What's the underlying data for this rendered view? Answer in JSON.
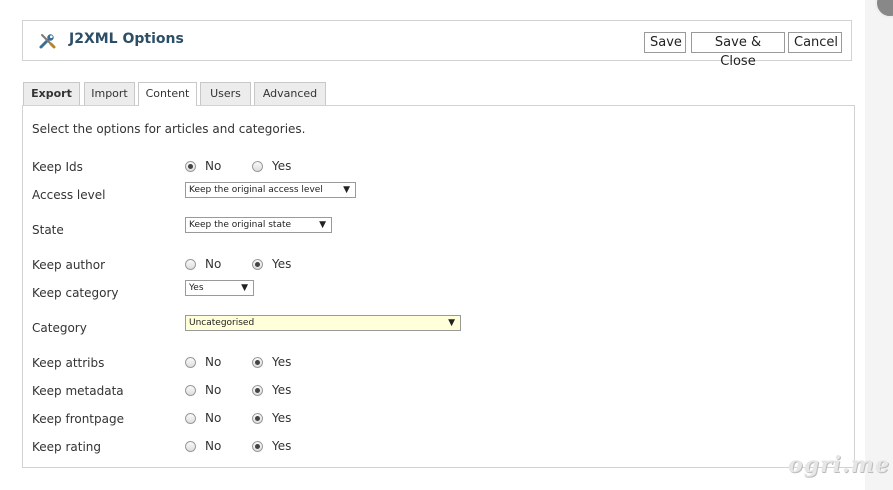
{
  "header": {
    "icon": "wrench-screwdriver-icon",
    "title": "J2XML Options"
  },
  "toolbar": {
    "save_label": "Save",
    "save_close_label": "Save & Close",
    "cancel_label": "Cancel"
  },
  "tabs": [
    {
      "label": "Export",
      "active": false
    },
    {
      "label": "Import",
      "active": false
    },
    {
      "label": "Content",
      "active": true
    },
    {
      "label": "Users",
      "active": false
    },
    {
      "label": "Advanced",
      "active": false
    }
  ],
  "content": {
    "intro": "Select the options for articles and categories.",
    "radio_no": "No",
    "radio_yes": "Yes",
    "keep_ids": {
      "label": "Keep Ids",
      "value": "No"
    },
    "access_level": {
      "label": "Access level",
      "value": "Keep the original access level"
    },
    "state": {
      "label": "State",
      "value": "Keep the original state"
    },
    "keep_author": {
      "label": "Keep author",
      "value": "Yes"
    },
    "keep_category": {
      "label": "Keep category",
      "value": "Yes"
    },
    "category": {
      "label": "Category",
      "value": "Uncategorised"
    },
    "keep_attribs": {
      "label": "Keep attribs",
      "value": "Yes"
    },
    "keep_metadata": {
      "label": "Keep metadata",
      "value": "Yes"
    },
    "keep_frontpage": {
      "label": "Keep frontpage",
      "value": "Yes"
    },
    "keep_rating": {
      "label": "Keep rating",
      "value": "Yes"
    }
  },
  "watermark": "ogri.me",
  "colors": {
    "title": "#2c4f66",
    "highlight_select": "#ffffd9"
  }
}
